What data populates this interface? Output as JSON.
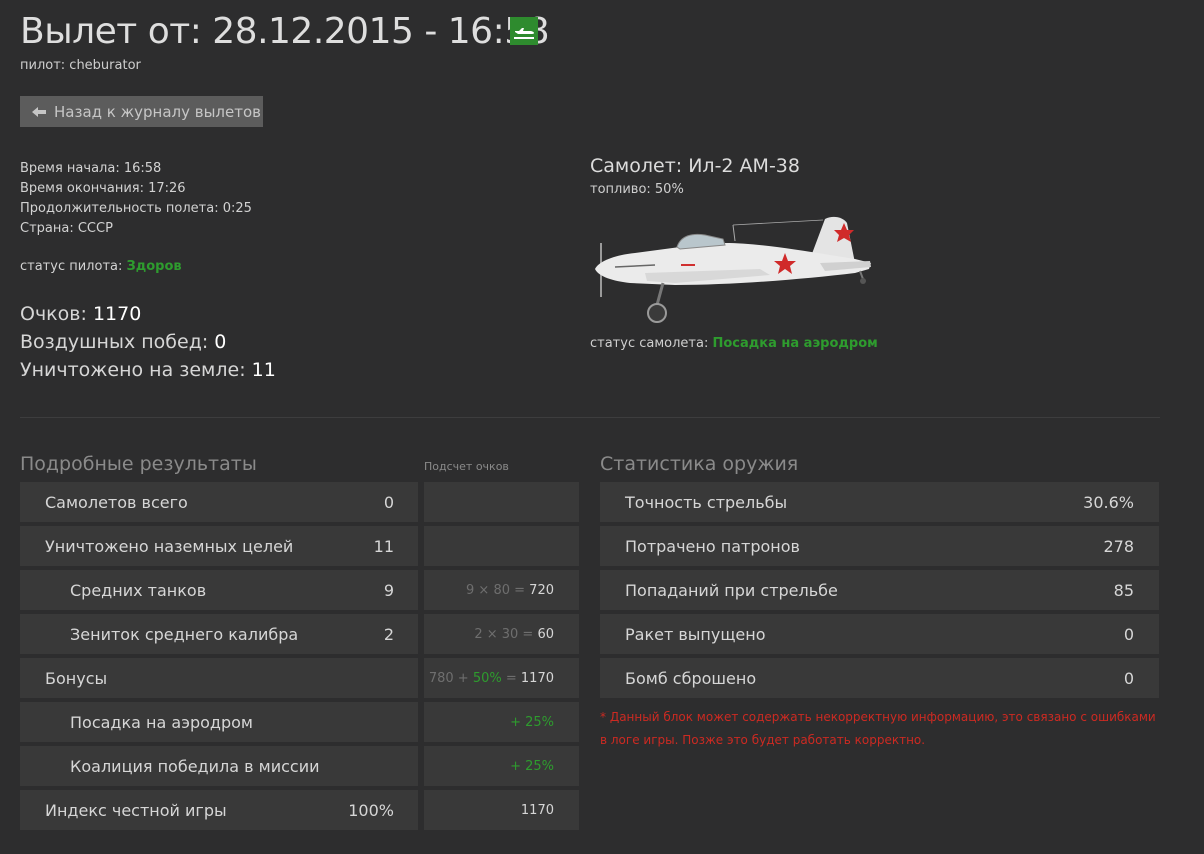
{
  "header": {
    "title": "Вылет от: 28.12.2015 - 16:58",
    "pilot": "пилот: cheburator",
    "back_button": "Назад к журналу вылетов",
    "landing_icon": "landing-plane-icon"
  },
  "flight": {
    "start": "Время начала: 16:58",
    "end": "Время окончания: 17:26",
    "duration": "Продолжительность полета: 0:25",
    "country": "Страна: СССР",
    "pilot_status_label": "статус пилота:",
    "pilot_status_value": "Здоров"
  },
  "scores": {
    "points_label": "Очков:",
    "points_value": "1170",
    "air_wins_label": "Воздушных побед:",
    "air_wins_value": "0",
    "ground_kills_label": "Уничтожено на земле:",
    "ground_kills_value": "11"
  },
  "plane": {
    "name": "Самолет: Ил-2 АМ-38",
    "fuel": "топливо: 50%",
    "status_label": "статус самолета:",
    "status_value": "Посадка на аэродром"
  },
  "results": {
    "heading": "Подробные результаты",
    "calc_heading": "Подсчет очков",
    "rows": [
      {
        "name": "Самолетов всего",
        "value": "0"
      },
      {
        "name": "Уничтожено наземных целей",
        "value": "11"
      },
      {
        "name": "Средних танков",
        "value": "9",
        "calc_muted": "9 × 80 =",
        "calc_result": "720"
      },
      {
        "name": "Зениток среднего калибра",
        "value": "2",
        "calc_muted": "2 × 30 =",
        "calc_result": "60"
      },
      {
        "name": "Бонусы",
        "calc_muted": "780 +",
        "calc_pct": "50%",
        "calc_eq": "=",
        "calc_result": "1170"
      },
      {
        "name": "Посадка на аэродром",
        "calc_pct": "+ 25%"
      },
      {
        "name": "Коалиция победила в миссии",
        "calc_pct": "+ 25%"
      },
      {
        "name": "Индекс честной игры",
        "value": "100%",
        "calc_result": "1170"
      }
    ]
  },
  "weapons": {
    "heading": "Статистика оружия",
    "rows": [
      {
        "name": "Точность стрельбы",
        "value": "30.6%"
      },
      {
        "name": "Потрачено патронов",
        "value": "278"
      },
      {
        "name": "Попаданий при стрельбе",
        "value": "85"
      },
      {
        "name": "Ракет выпущено",
        "value": "0"
      },
      {
        "name": "Бомб сброшено",
        "value": "0"
      }
    ],
    "note": "* Данный блок может содержать некорректную информацию, это связано с ошибками в логе игры. Позже это будет работать корректно."
  },
  "colors": {
    "background": "#2d2d2e",
    "cell": "#393939",
    "green": "#2e9c2e",
    "note_red": "#cc2a22"
  }
}
